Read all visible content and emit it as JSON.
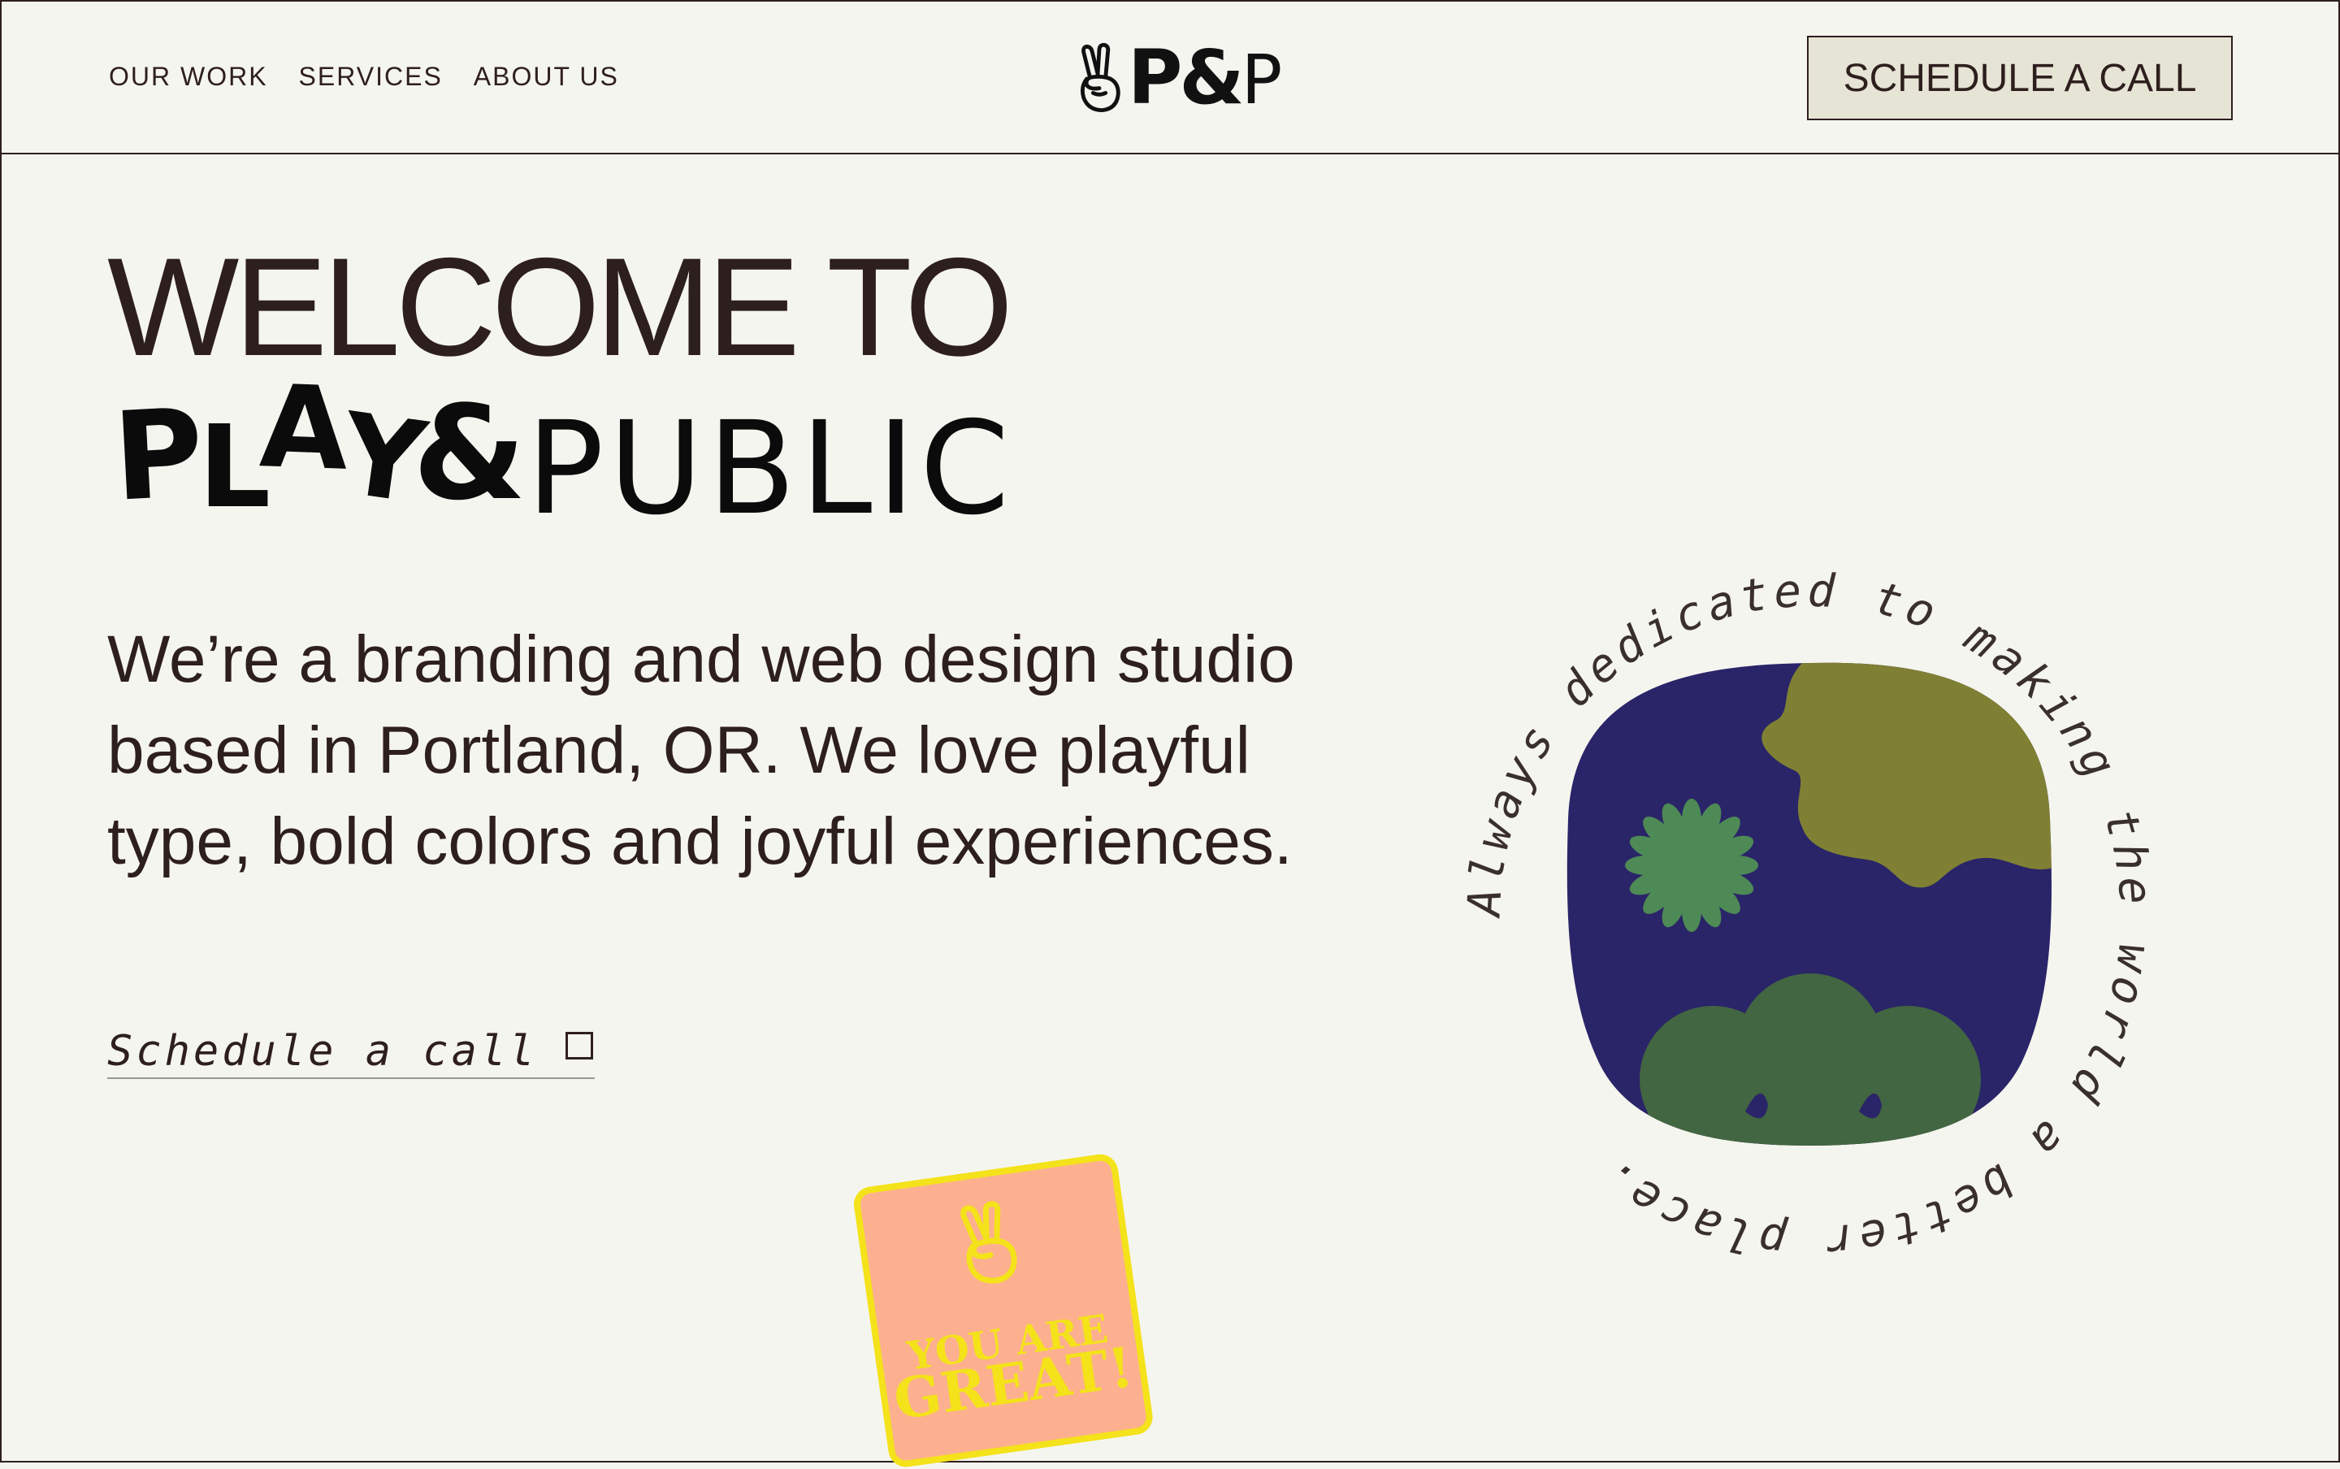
{
  "nav": {
    "items": [
      "OUR WORK",
      "SERVICES",
      "ABOUT US"
    ]
  },
  "logo": {
    "text_main": "P&",
    "text_end": "P",
    "icon": "peace-hand-icon"
  },
  "header": {
    "cta_label": "SCHEDULE A CALL"
  },
  "hero": {
    "line1": "WELCOME TO",
    "play_letters": [
      "P",
      "L",
      "A",
      "Y",
      "&"
    ],
    "public_word": "PUBLIC",
    "intro": "We’re a branding and web design studio based in Portland, OR. We love playful type, bold colors and joyful experiences.",
    "schedule_link": "Schedule a call",
    "schedule_icon": "square-icon"
  },
  "badge": {
    "circle_text": "Always dedicated to making the world a better place. ",
    "colors": {
      "navy": "#2a2468",
      "olive": "#7f8033",
      "green_flower": "#4e8a55",
      "dark_green": "#426641",
      "text": "#3a2f2f"
    }
  },
  "sticker": {
    "line1": "YOU ARE",
    "line2": "GREAT!",
    "icon": "peace-hand-icon",
    "colors": {
      "bg": "#fcb08f",
      "accent": "#f4e21a"
    }
  },
  "theme": {
    "background": "#f5f5ef",
    "ink": "#2e1f1f",
    "button_bg": "#e6e4d4"
  }
}
